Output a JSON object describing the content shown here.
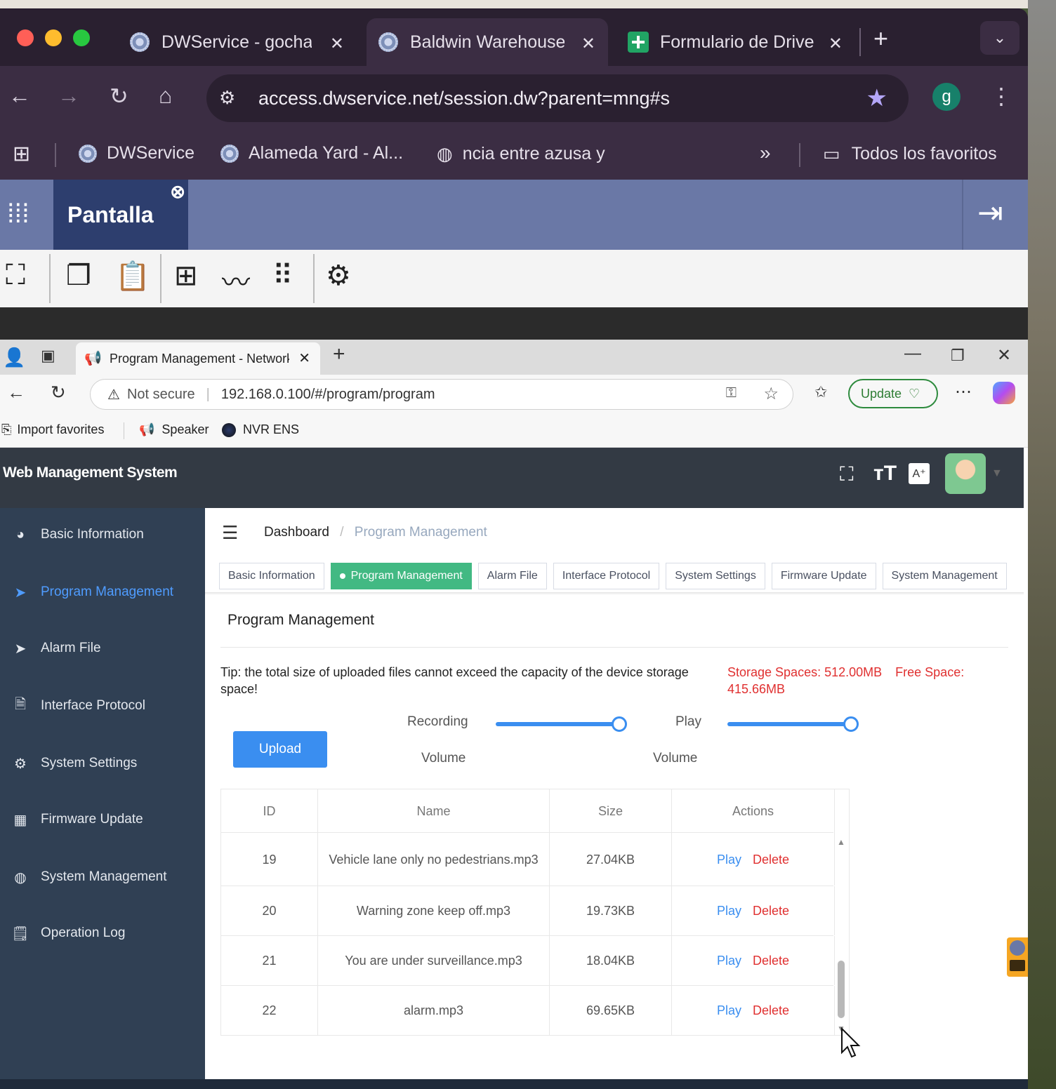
{
  "chrome": {
    "tabs": [
      {
        "title": "DWService - gocha",
        "icon": "dwservice-gear-icon"
      },
      {
        "title": "Baldwin Warehouse",
        "icon": "dwservice-gear-icon",
        "active": true
      },
      {
        "title": "Formulario de Drive",
        "icon": "google-sheets-icon"
      }
    ],
    "new_tab": "+",
    "url": "access.dwservice.net/session.dw?parent=mng#s",
    "profile_initial": "g",
    "bookmarks": [
      {
        "label": "DWService"
      },
      {
        "label": "Alameda Yard - Al..."
      },
      {
        "label": "ncia entre azusa y"
      }
    ],
    "all_bookmarks": "Todos los favoritos"
  },
  "dwservice": {
    "tab_label": "Pantalla"
  },
  "edge": {
    "tab_title": "Program Management - Network",
    "not_secure": "Not secure",
    "url": "192.168.0.100/#/program/program",
    "update_label": "Update",
    "favorites": [
      "Import favorites",
      "Speaker",
      "NVR ENS"
    ]
  },
  "wms": {
    "title": "Web Management System",
    "sidebar": [
      {
        "label": "Basic Information",
        "icon": "dashboard-icon"
      },
      {
        "label": "Program Management",
        "icon": "paper-plane-icon",
        "active": true
      },
      {
        "label": "Alarm File",
        "icon": "paper-plane-icon"
      },
      {
        "label": "Interface Protocol",
        "icon": "document-icon"
      },
      {
        "label": "System Settings",
        "icon": "gear-icon"
      },
      {
        "label": "Firmware Update",
        "icon": "grid-icon"
      },
      {
        "label": "System Management",
        "icon": "globe-icon"
      },
      {
        "label": "Operation Log",
        "icon": "log-icon"
      }
    ],
    "breadcrumb": {
      "home": "Dashboard",
      "separator": "/",
      "current": "Program Management"
    },
    "tabs": [
      "Basic Information",
      "Program Management",
      "Alarm File",
      "Interface Protocol",
      "System Settings",
      "Firmware Update",
      "System Management"
    ],
    "active_tab": "Program Management",
    "heading": "Program Management",
    "tip": "Tip: the total size of uploaded files cannot exceed the capacity of the device storage space!",
    "storage": "Storage Spaces: 512.00MB",
    "free_space": "Free Space: 415.66MB",
    "upload_label": "Upload",
    "recording_label": "Recording",
    "recording_sub": "Volume",
    "play_label": "Play",
    "play_sub": "Volume",
    "recording_volume": 1.0,
    "play_volume": 1.0,
    "table": {
      "headers": [
        "ID",
        "Name",
        "Size",
        "Actions"
      ],
      "rows": [
        {
          "id": "19",
          "name": "Vehicle lane only no pedestrians.mp3",
          "size": "27.04KB"
        },
        {
          "id": "20",
          "name": "Warning zone keep off.mp3",
          "size": "19.73KB"
        },
        {
          "id": "21",
          "name": "You are under surveillance.mp3",
          "size": "18.04KB"
        },
        {
          "id": "22",
          "name": "alarm.mp3",
          "size": "69.65KB"
        }
      ],
      "play_label": "Play",
      "delete_label": "Delete"
    }
  },
  "colors": {
    "chrome_frame": "#3b2d43",
    "dw_bar": "#6a78a6",
    "sidebar": "#304054",
    "accent": "#3a8ef0",
    "active_tab": "#42b983",
    "danger": "#e03030"
  }
}
